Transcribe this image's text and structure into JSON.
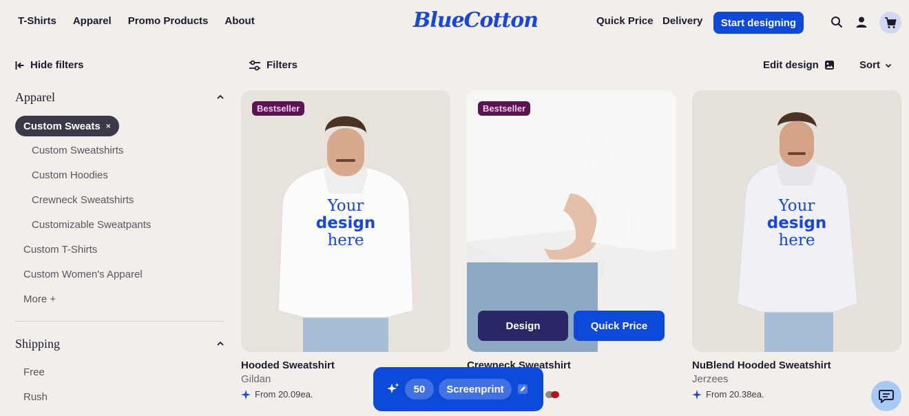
{
  "header": {
    "nav_left": [
      "T-Shirts",
      "Apparel",
      "Promo Products",
      "About"
    ],
    "logo": "BlueCotton",
    "quick_price": "Quick Price",
    "delivery": "Delivery",
    "start_designing": "Start designing"
  },
  "sidebar": {
    "hide_filters": "Hide filters",
    "apparel_title": "Apparel",
    "active_chip": "Custom Sweats",
    "chip_remove": "×",
    "sub_items": [
      "Custom Sweatshirts",
      "Custom Hoodies",
      "Crewneck Sweatshirts",
      "Customizable Sweatpants"
    ],
    "items": [
      "Custom T-Shirts",
      "Custom Women's Apparel",
      "More +"
    ],
    "shipping_title": "Shipping",
    "shipping_items": [
      "Free",
      "Rush"
    ]
  },
  "toolbar": {
    "filters": "Filters",
    "edit_design": "Edit design",
    "sort": "Sort"
  },
  "products": [
    {
      "badge": "Bestseller",
      "title": "Hooded Sweatshirt",
      "brand": "Gildan",
      "price": "From 20.09ea.",
      "print_line1": "Your",
      "print_line2": "design",
      "print_line3": "here"
    },
    {
      "badge": "Bestseller",
      "title": "Crewneck Sweatshirt",
      "design_btn": "Design",
      "quick_btn": "Quick Price"
    },
    {
      "title": "NuBlend Hooded Sweatshirt",
      "brand": "Jerzees",
      "price": "From 20.38ea.",
      "print_line1": "Your",
      "print_line2": "design",
      "print_line3": "here"
    }
  ],
  "floating_bar": {
    "quantity": "50",
    "method": "Screenprint"
  },
  "colors": {
    "brand_blue": "#0d4ad9",
    "dark_navy": "#2a2766",
    "badge_purple": "#5a1452"
  }
}
